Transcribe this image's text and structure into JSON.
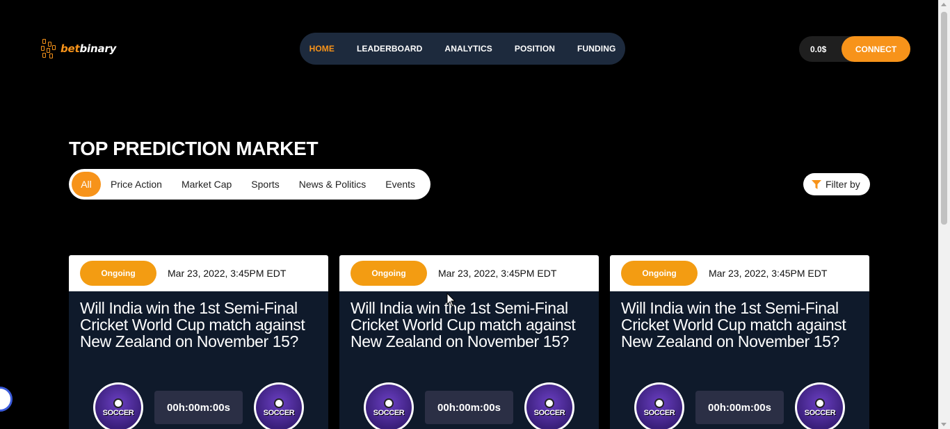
{
  "header": {
    "logo": {
      "prefix": "bet",
      "suffix": "binary"
    },
    "nav": [
      {
        "label": "HOME",
        "active": true
      },
      {
        "label": "LEADERBOARD",
        "active": false
      },
      {
        "label": "ANALYTICS",
        "active": false
      },
      {
        "label": "POSITION",
        "active": false
      },
      {
        "label": "FUNDING",
        "active": false
      }
    ],
    "balance": "0.0$",
    "connect_label": "CONNECT"
  },
  "section": {
    "title": "TOP PREDICTION MARKET",
    "tabs": [
      {
        "label": "All",
        "active": true
      },
      {
        "label": "Price Action",
        "active": false
      },
      {
        "label": "Market Cap",
        "active": false
      },
      {
        "label": "Sports",
        "active": false
      },
      {
        "label": "News & Politics",
        "active": false
      },
      {
        "label": "Events",
        "active": false
      }
    ],
    "filter_label": "Filter by"
  },
  "cards": [
    {
      "status": "Ongoing",
      "date": "Mar 23, 2022, 3:45PM EDT",
      "question": "Will India win the 1st Semi-Final Cricket World Cup match against New Zealand on November 15?",
      "timer": "00h:00m:00s",
      "team_left": "SOCCER",
      "team_right": "SOCCER"
    },
    {
      "status": "Ongoing",
      "date": "Mar 23, 2022, 3:45PM EDT",
      "question": "Will India win the 1st Semi-Final Cricket World Cup match against New Zealand on November 15?",
      "timer": "00h:00m:00s",
      "team_left": "SOCCER",
      "team_right": "SOCCER"
    },
    {
      "status": "Ongoing",
      "date": "Mar 23, 2022, 3:45PM EDT",
      "question": "Will India win the 1st Semi-Final Cricket World Cup match against New Zealand on November 15?",
      "timer": "00h:00m:00s",
      "team_left": "SOCCER",
      "team_right": "SOCCER"
    }
  ],
  "colors": {
    "accent": "#f7931a",
    "nav_bg": "#1d2a3d",
    "card_bg": "#0f1a2b",
    "timer_bg": "#2b2f45"
  },
  "icons": [
    "logo-mark-icon",
    "funnel-icon",
    "soccer-badge-icon",
    "cursor-icon"
  ]
}
